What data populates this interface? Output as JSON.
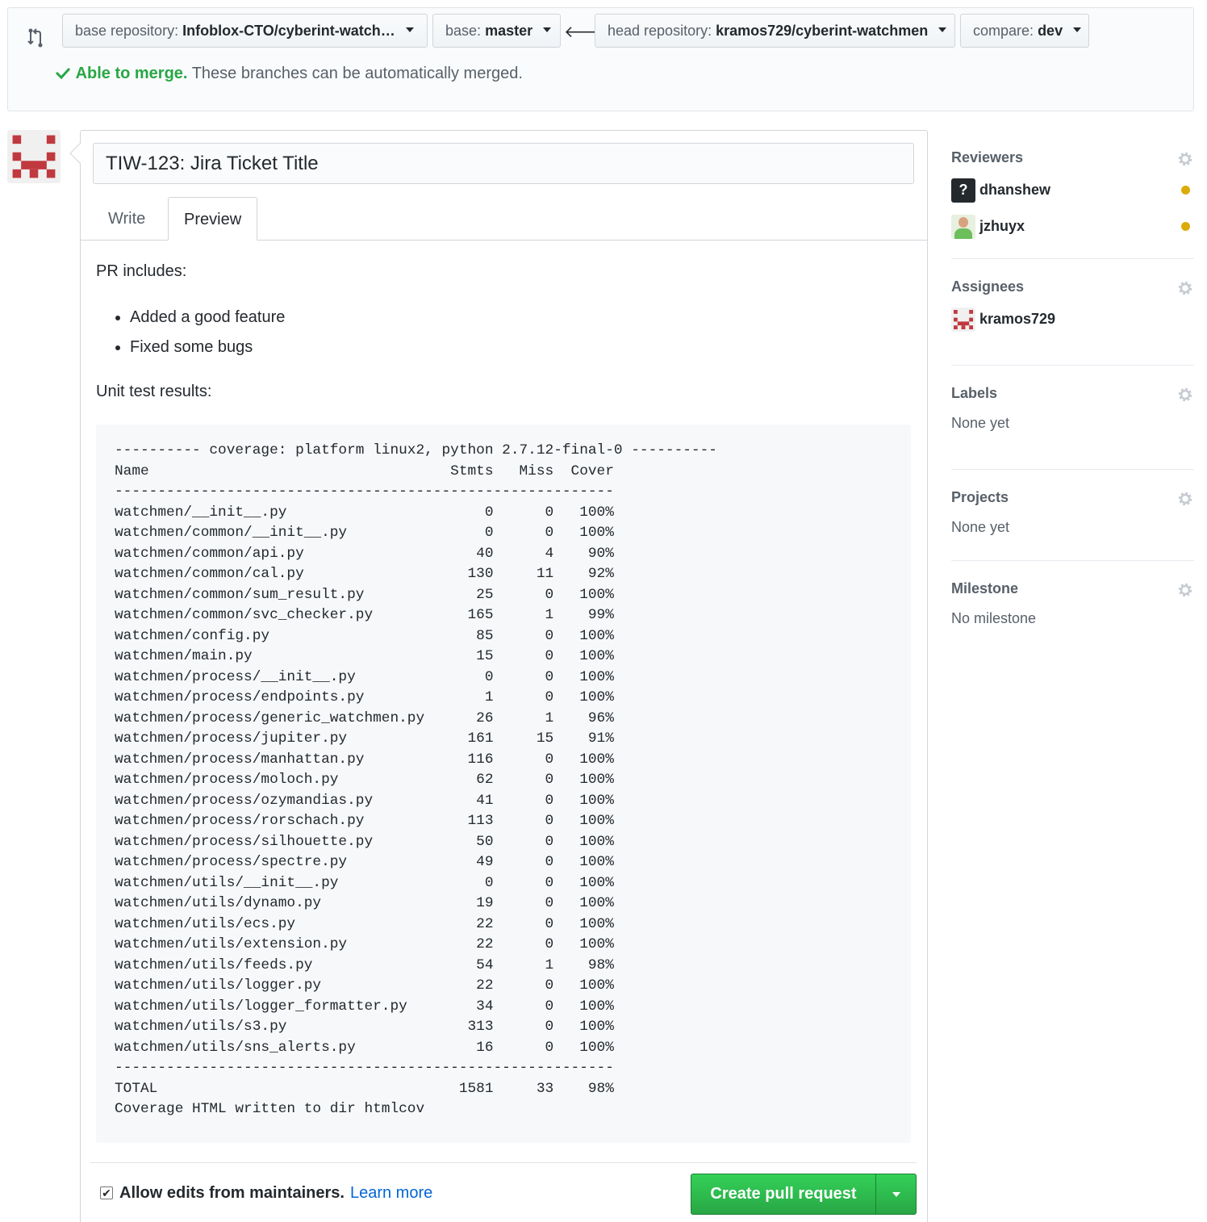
{
  "compare": {
    "base_repo_label": "base repository:",
    "base_repo_value": "Infoblox-CTO/cyberint-watch…",
    "base_label": "base:",
    "base_value": "master",
    "head_repo_label": "head repository:",
    "head_repo_value": "kramos729/cyberint-watchmen",
    "compare_label": "compare:",
    "compare_value": "dev",
    "merge_ok": "Able to merge.",
    "merge_msg": "These branches can be automatically merged."
  },
  "form": {
    "title_value": "TIW-123: Jira Ticket Title",
    "tabs": [
      "Write",
      "Preview"
    ],
    "active_tab": "Preview",
    "preview": {
      "intro": "PR includes:",
      "bullets": [
        "Added a good feature",
        "Fixed some bugs"
      ],
      "results_label": "Unit test results:",
      "coverage_header": "---------- coverage: platform linux2, python 2.7.12-final-0 ----------",
      "columns": [
        "Name",
        "Stmts",
        "Miss",
        "Cover"
      ],
      "rows": [
        [
          "watchmen/__init__.py",
          "0",
          "0",
          "100%"
        ],
        [
          "watchmen/common/__init__.py",
          "0",
          "0",
          "100%"
        ],
        [
          "watchmen/common/api.py",
          "40",
          "4",
          "90%"
        ],
        [
          "watchmen/common/cal.py",
          "130",
          "11",
          "92%"
        ],
        [
          "watchmen/common/sum_result.py",
          "25",
          "0",
          "100%"
        ],
        [
          "watchmen/common/svc_checker.py",
          "165",
          "1",
          "99%"
        ],
        [
          "watchmen/config.py",
          "85",
          "0",
          "100%"
        ],
        [
          "watchmen/main.py",
          "15",
          "0",
          "100%"
        ],
        [
          "watchmen/process/__init__.py",
          "0",
          "0",
          "100%"
        ],
        [
          "watchmen/process/endpoints.py",
          "1",
          "0",
          "100%"
        ],
        [
          "watchmen/process/generic_watchmen.py",
          "26",
          "1",
          "96%"
        ],
        [
          "watchmen/process/jupiter.py",
          "161",
          "15",
          "91%"
        ],
        [
          "watchmen/process/manhattan.py",
          "116",
          "0",
          "100%"
        ],
        [
          "watchmen/process/moloch.py",
          "62",
          "0",
          "100%"
        ],
        [
          "watchmen/process/ozymandias.py",
          "41",
          "0",
          "100%"
        ],
        [
          "watchmen/process/rorschach.py",
          "113",
          "0",
          "100%"
        ],
        [
          "watchmen/process/silhouette.py",
          "50",
          "0",
          "100%"
        ],
        [
          "watchmen/process/spectre.py",
          "49",
          "0",
          "100%"
        ],
        [
          "watchmen/utils/__init__.py",
          "0",
          "0",
          "100%"
        ],
        [
          "watchmen/utils/dynamo.py",
          "19",
          "0",
          "100%"
        ],
        [
          "watchmen/utils/ecs.py",
          "22",
          "0",
          "100%"
        ],
        [
          "watchmen/utils/extension.py",
          "22",
          "0",
          "100%"
        ],
        [
          "watchmen/utils/feeds.py",
          "54",
          "1",
          "98%"
        ],
        [
          "watchmen/utils/logger.py",
          "22",
          "0",
          "100%"
        ],
        [
          "watchmen/utils/logger_formatter.py",
          "34",
          "0",
          "100%"
        ],
        [
          "watchmen/utils/s3.py",
          "313",
          "0",
          "100%"
        ],
        [
          "watchmen/utils/sns_alerts.py",
          "16",
          "0",
          "100%"
        ]
      ],
      "total": [
        "TOTAL",
        "1581",
        "33",
        "98%"
      ],
      "footer_line": "Coverage HTML written to dir htmlcov"
    },
    "maintainers_label": "Allow edits from maintainers.",
    "learn_more": "Learn more",
    "create_button": "Create pull request"
  },
  "sidebar": {
    "reviewers": {
      "label": "Reviewers",
      "people": [
        "dhanshew",
        "jzhuyx"
      ]
    },
    "assignees": {
      "label": "Assignees",
      "people": [
        "kramos729"
      ]
    },
    "labels": {
      "label": "Labels",
      "empty": "None yet"
    },
    "projects": {
      "label": "Projects",
      "empty": "None yet"
    },
    "milestone": {
      "label": "Milestone",
      "empty": "No milestone"
    }
  },
  "colors": {
    "success": "#28a745",
    "link": "#0366d6",
    "pending_dot": "#dbab09",
    "avatar_red": "#c0393f"
  },
  "icons": [
    "compare-arrows-icon",
    "caret-down-icon",
    "arrow-left-icon",
    "check-icon",
    "gear-icon",
    "identicon-avatar"
  ]
}
